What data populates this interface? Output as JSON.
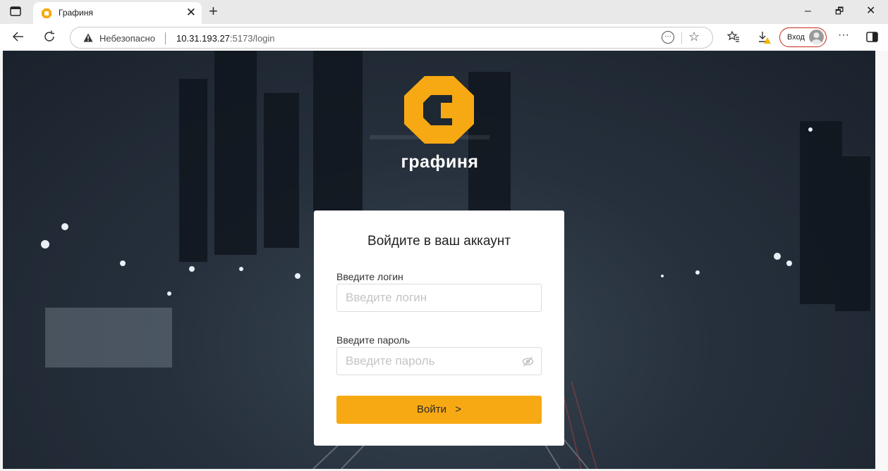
{
  "browser": {
    "tab_title": "Графиня",
    "tab_close": "✕",
    "new_tab": "+",
    "window_controls": {
      "minimize": "–",
      "restore": "🗗",
      "close": "✕"
    },
    "address": {
      "security_label": "Небезопасно",
      "host": "10.31.193.27",
      "path": ":5173/login"
    },
    "profile_label": "Вход",
    "more_menu": "···"
  },
  "page": {
    "brand_name": "графиня",
    "brand_color": "#f7a913",
    "form": {
      "title": "Войдите в ваш аккаунт",
      "login_label": "Введите логин",
      "login_placeholder": "Введите логин",
      "password_label": "Введите пароль",
      "password_placeholder": "Введите пароль",
      "submit_label": "Войти",
      "submit_arrow": ">"
    }
  },
  "icons": [
    "window-menu-icon",
    "tab-favicon-icon",
    "close-icon",
    "plus-icon",
    "back-icon",
    "reload-icon",
    "warning-icon",
    "more-options-icon",
    "star-icon",
    "favorites-icon",
    "download-icon",
    "avatar-icon",
    "sidebar-icon",
    "eye-off-icon",
    "chevron-right-icon"
  ]
}
